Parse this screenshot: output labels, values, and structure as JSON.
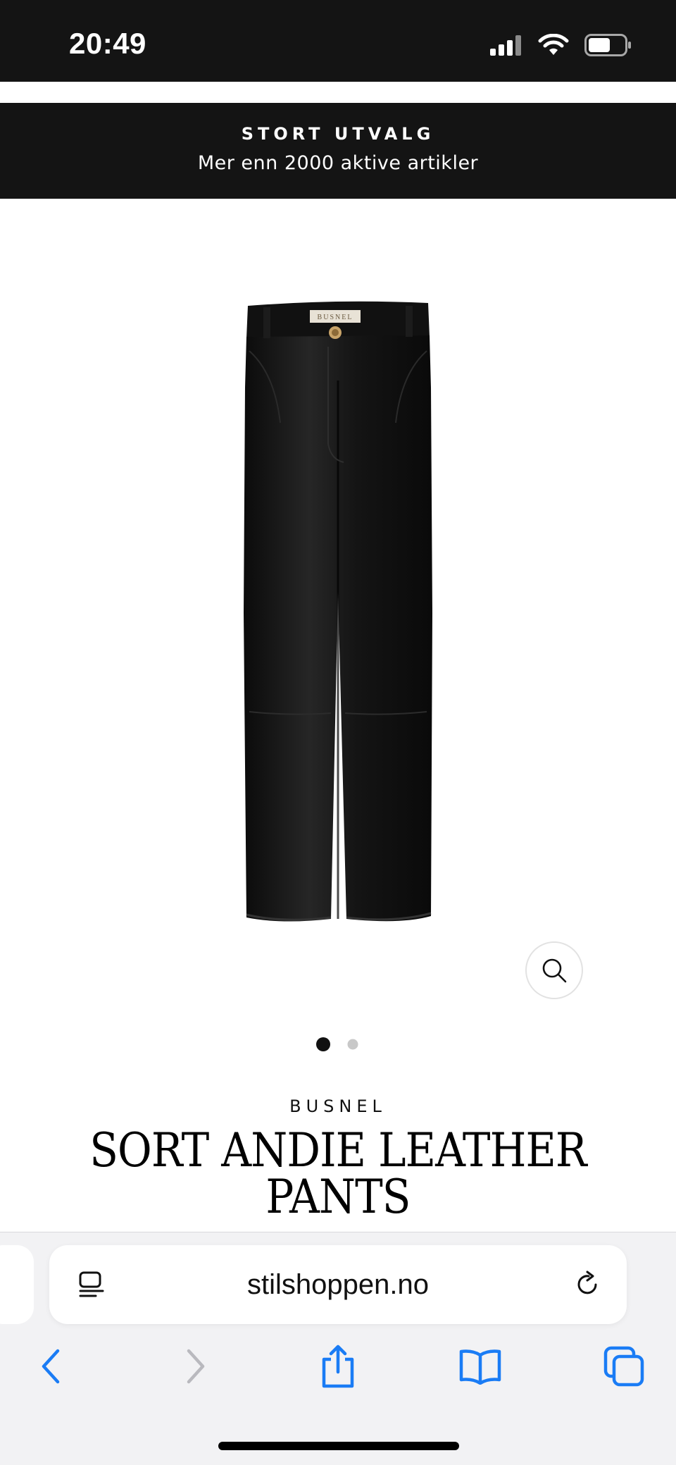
{
  "status_bar": {
    "time": "20:49"
  },
  "promo": {
    "title": "STORT UTVALG",
    "subtitle": "Mer enn 2000 aktive artikler"
  },
  "product": {
    "brand": "BUSNEL",
    "title": "SORT ANDIE LEATHER PANTS",
    "image_label": "BUSNEL",
    "gallery": {
      "count": 2,
      "active_index": 1
    }
  },
  "browser": {
    "url": "stilshoppen.no"
  },
  "colors": {
    "dark": "#141414",
    "accent_blue": "#1a7cf5",
    "inactive_gray": "#b9b9be"
  },
  "icons": {
    "zoom": "magnifier-icon",
    "reader": "reader-mode-icon",
    "reload": "reload-icon",
    "back": "chevron-left-icon",
    "forward": "chevron-right-icon",
    "share": "share-icon",
    "bookmarks": "book-icon",
    "tabs": "tabs-icon"
  }
}
